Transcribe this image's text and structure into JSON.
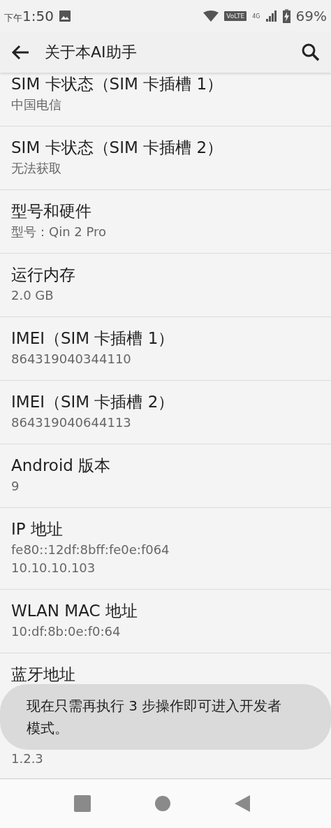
{
  "status_bar": {
    "time_prefix": "下午",
    "time": "1:50",
    "volte": "VoLTE",
    "network": "4G",
    "battery": "69%"
  },
  "app_bar": {
    "title": "关于本AI助手"
  },
  "items": [
    {
      "title": "SIM 卡状态（SIM 卡插槽 1）",
      "values": [
        "中国电信"
      ]
    },
    {
      "title": "SIM 卡状态（SIM 卡插槽 2）",
      "values": [
        "无法获取"
      ]
    },
    {
      "title": "型号和硬件",
      "values": [
        "型号：Qin 2 Pro"
      ]
    },
    {
      "title": "运行内存",
      "values": [
        "2.0 GB"
      ]
    },
    {
      "title": "IMEI（SIM 卡插槽 1）",
      "values": [
        "864319040344110"
      ]
    },
    {
      "title": "IMEI（SIM 卡插槽 2）",
      "values": [
        "864319040644113"
      ]
    },
    {
      "title": "Android 版本",
      "values": [
        "9"
      ]
    },
    {
      "title": "IP 地址",
      "values": [
        "fe80::12df:8bff:fe0e:f064",
        "10.10.10.103"
      ]
    },
    {
      "title": "WLAN MAC 地址",
      "values": [
        "10:df:8b:0e:f0:64"
      ]
    },
    {
      "title": "蓝牙地址"
    },
    {
      "values": [
        "1.2.3"
      ]
    }
  ],
  "toast": {
    "text": "现在只需再执行 3 步操作即可进入开发者模式。"
  }
}
